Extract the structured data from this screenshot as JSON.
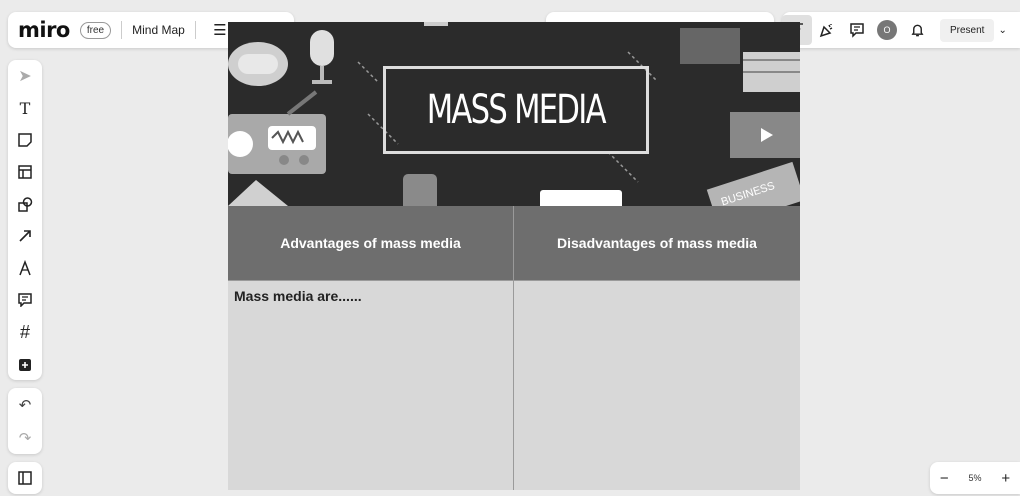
{
  "header": {
    "logo": "miro",
    "plan_badge": "free",
    "board_name": "Mind Map"
  },
  "toolbar_right": {
    "present_label": "Present",
    "avatar_initial": "O"
  },
  "board": {
    "banner_title": "MASS MEDIA",
    "columns": [
      {
        "header": "Advantages of mass media",
        "body": "Mass media are......"
      },
      {
        "header": "Disadvantages of mass media",
        "body": ""
      }
    ]
  },
  "zoom": {
    "level": "5%",
    "minus": "−",
    "plus": "+"
  }
}
